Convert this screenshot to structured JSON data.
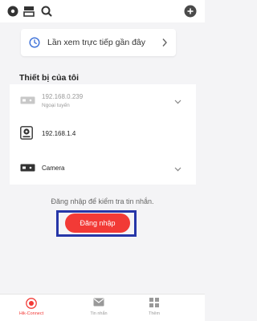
{
  "colors": {
    "accent": "#f23a36",
    "highlight_border": "#2636a8",
    "clock_blue": "#3a6fd8",
    "background": "#f4f4f6",
    "muted_text": "#999999"
  },
  "topbar": {
    "icons": [
      "record-icon",
      "layout-icon",
      "search-icon",
      "add-icon"
    ]
  },
  "recent": {
    "label": "Lần xem trực tiếp gần đây",
    "icon": "clock-icon"
  },
  "devices_title": "Thiết bị của tôi",
  "devices": [
    {
      "name": "192.168.0.239",
      "status": "Ngoại tuyến",
      "icon": "nvr-icon",
      "expandable": true
    },
    {
      "name": "192.168.1.4",
      "status": "",
      "icon": "camera-icon",
      "expandable": false
    },
    {
      "name": "Camera",
      "status": "",
      "icon": "nvr-icon",
      "expandable": true
    }
  ],
  "login": {
    "message": "Đăng nhập để kiểm tra tin nhắn.",
    "button_label": "Đăng nhập"
  },
  "bottom_nav": [
    {
      "label": "Hik-Connect",
      "icon": "hik-connect-icon",
      "active": true
    },
    {
      "label": "Tin nhắn",
      "icon": "message-icon",
      "active": false
    },
    {
      "label": "Thêm",
      "icon": "more-icon",
      "active": false
    }
  ]
}
